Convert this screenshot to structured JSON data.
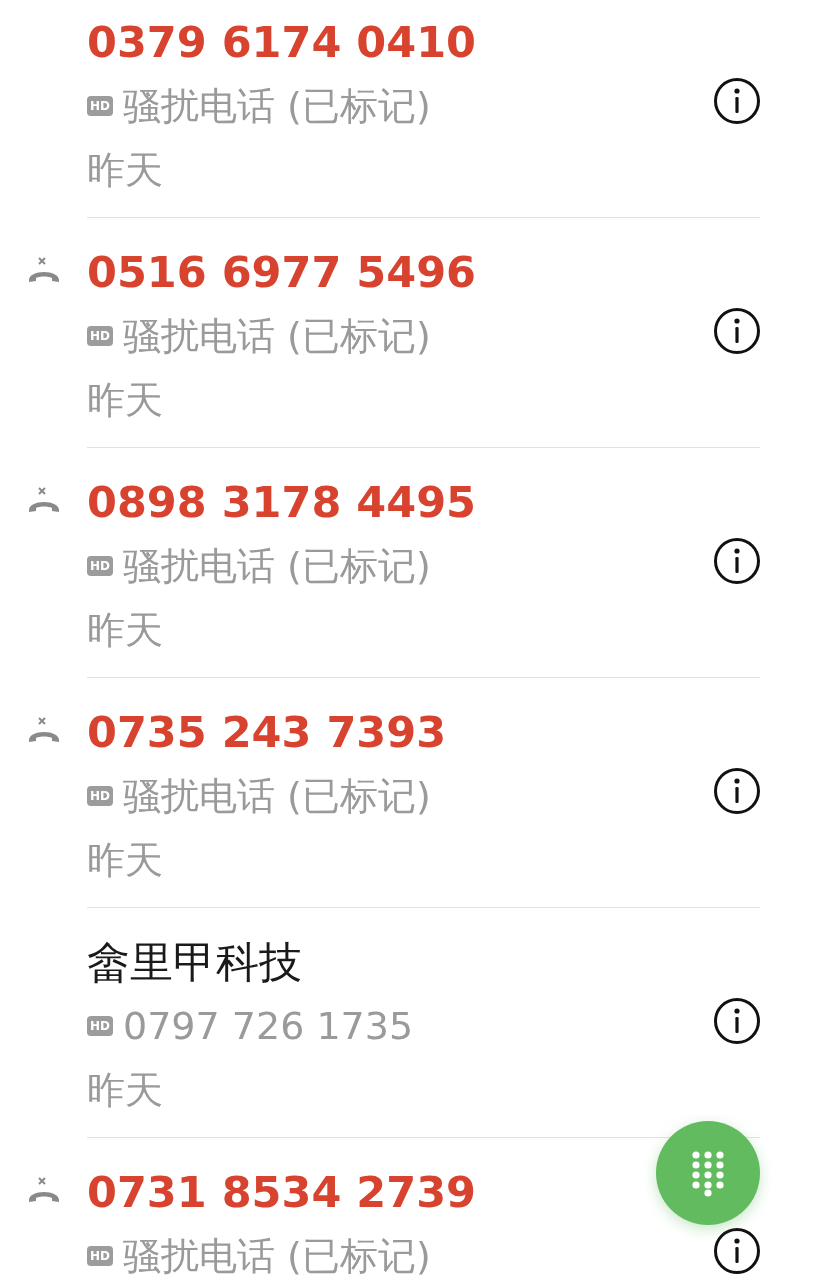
{
  "calls": [
    {
      "number": "0379 6174 0410",
      "kind": "spam",
      "missed": false,
      "badge": "HD",
      "detail": "骚扰电话 (已标记)",
      "date": "昨天"
    },
    {
      "number": "0516 6977 5496",
      "kind": "spam",
      "missed": true,
      "badge": "HD",
      "detail": "骚扰电话 (已标记)",
      "date": "昨天"
    },
    {
      "number": "0898 3178 4495",
      "kind": "spam",
      "missed": true,
      "badge": "HD",
      "detail": "骚扰电话 (已标记)",
      "date": "昨天"
    },
    {
      "number": "0735 243 7393",
      "kind": "spam",
      "missed": true,
      "badge": "HD",
      "detail": "骚扰电话 (已标记)",
      "date": "昨天"
    },
    {
      "number": "畲里甲科技",
      "kind": "contact",
      "missed": false,
      "badge": "HD",
      "detail": "0797 726 1735",
      "date": "昨天"
    },
    {
      "number": "0731 8534 2739",
      "kind": "spam",
      "missed": true,
      "badge": "HD",
      "detail": "骚扰电话 (已标记)"
    }
  ]
}
